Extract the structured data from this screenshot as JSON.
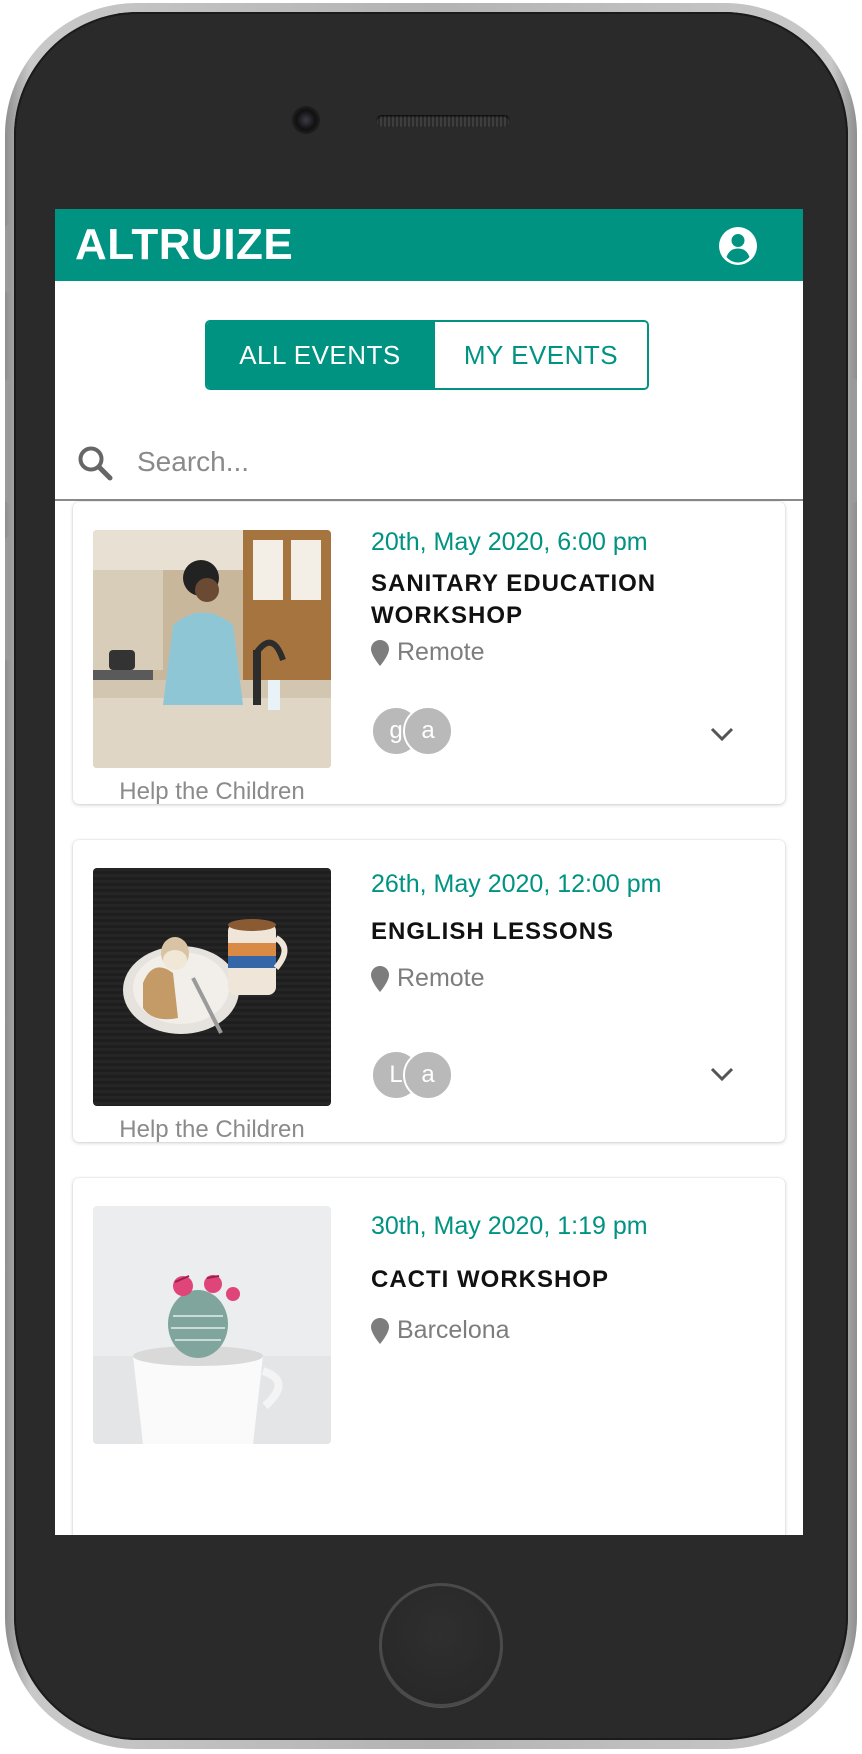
{
  "app": {
    "title": "ALTRUIZE"
  },
  "colors": {
    "primary": "#009382",
    "frame": "#2a2a2b",
    "muted_text": "#8b8b8b",
    "avatar_bg": "#b9b9b9"
  },
  "icons": {
    "account": "account-circle-icon",
    "search": "search-icon",
    "location": "map-pin-icon",
    "expand": "chevron-down-icon"
  },
  "tabs": {
    "all_events": "ALL EVENTS",
    "my_events": "MY EVENTS",
    "selected": "ALL EVENTS"
  },
  "search": {
    "placeholder": "Search...",
    "value": ""
  },
  "events": [
    {
      "date": "20th, May 2020, 6:00 pm",
      "title": "SANITARY EDUCATION WORKSHOP",
      "location": "Remote",
      "organizer": "Help the Children",
      "participants": [
        "g",
        "a"
      ]
    },
    {
      "date": "26th, May 2020, 12:00 pm",
      "title": "ENGLISH LESSONS",
      "location": "Remote",
      "organizer": "Help the Children",
      "participants": [
        "L",
        "a"
      ]
    },
    {
      "date": "30th, May 2020, 1:19 pm",
      "title": "CACTI WORKSHOP",
      "location": "Barcelona"
    }
  ]
}
